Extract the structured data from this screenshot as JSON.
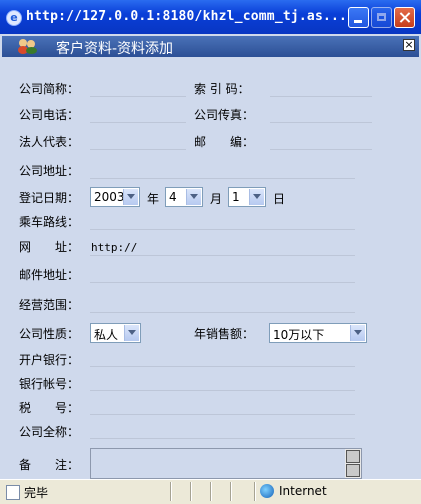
{
  "window": {
    "title": "http://127.0.0.1:8180/khzl_comm_tj.as..."
  },
  "dialog": {
    "title": "客户资料-资料添加",
    "close_glyph": "×"
  },
  "form": {
    "company_short_label": "公司简称：",
    "index_code_label": "索 引 码：",
    "company_phone_label": "公司电话：",
    "company_fax_label": "公司传真：",
    "legal_rep_label": "法人代表：",
    "postcode_label": "邮　　编：",
    "company_address_label": "公司地址：",
    "register_date_label": "登记日期：",
    "year_value": "2003",
    "year_unit": "年",
    "month_value": "4",
    "month_unit": "月",
    "day_value": "1",
    "day_unit": "日",
    "route_label": "乘车路线：",
    "website_label": "网　　址：",
    "website_value": "http://",
    "mail_address_label": "邮件地址：",
    "business_scope_label": "经营范围：",
    "company_type_label": "公司性质：",
    "company_type_value": "私人",
    "annual_sales_label": "年销售额：",
    "annual_sales_value": "10万以下",
    "bank_label": "开户银行：",
    "bank_account_label": "银行帐号：",
    "tax_label": "税　　号：",
    "full_name_label": "公司全称：",
    "remarks_label": "备　　注："
  },
  "status": {
    "text": "完毕",
    "zone": "Internet"
  }
}
